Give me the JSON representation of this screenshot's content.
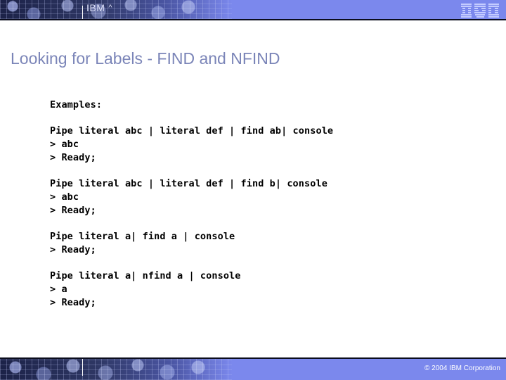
{
  "header": {
    "brand_text": "IBM",
    "brand_mark": "^",
    "logo_alt": "IBM",
    "band_color": "#7b88ed",
    "art_dark_color": "#1c2248"
  },
  "slide": {
    "title": "Looking for Labels - FIND and NFIND",
    "title_color": "#7b85b8"
  },
  "code": {
    "lines": [
      "Examples:",
      "",
      "Pipe literal abc | literal def | find ab| console",
      "> abc",
      "> Ready;",
      "",
      "Pipe literal abc | literal def | find b| console",
      "> abc",
      "> Ready;",
      "",
      "Pipe literal a| find a | console",
      "> Ready;",
      "",
      "Pipe literal a| nfind a | console",
      "> a",
      "> Ready;"
    ]
  },
  "footer": {
    "copyright": "© 2004 IBM Corporation",
    "band_color": "#7b88ed"
  }
}
